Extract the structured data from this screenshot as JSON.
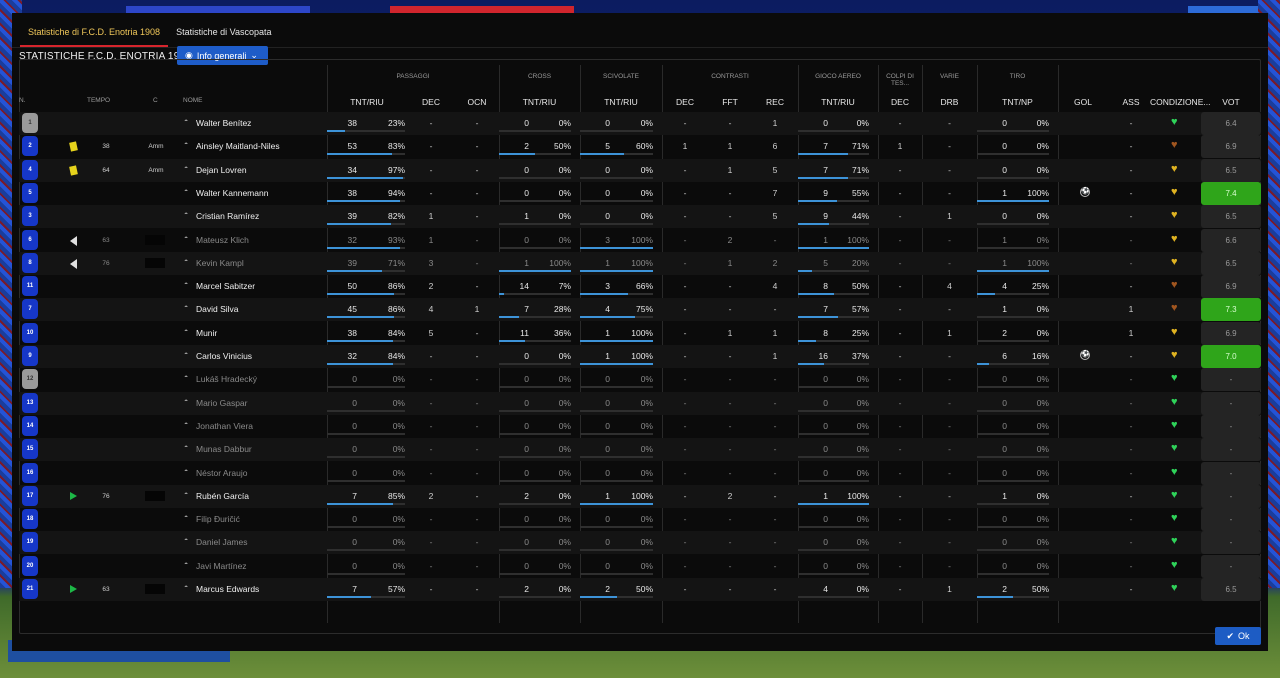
{
  "tabs": [
    {
      "label": "Statistiche di F.C.D. Enotria 1908",
      "active": true
    },
    {
      "label": "Statistiche di Vascopata",
      "active": false
    }
  ],
  "section_title": "STATISTICHE F.C.D. ENOTRIA 1908",
  "info_button": "Info generali",
  "groups": {
    "passaggi": "PASSAGGI",
    "cross": "CROSS",
    "scivolate": "SCIVOLATE",
    "contrasti": "CONTRASTI",
    "gioco_aereo": "GIOCO AEREO",
    "colpi_testa": "COLPI DI TES...",
    "varie": "VARIE",
    "tiro": "TIRO"
  },
  "columns": {
    "n": "N.",
    "tempo": "TEMPO",
    "c": "C",
    "nome": "NOME",
    "pas_tnt": "TNT/RIU",
    "pas_dec": "DEC",
    "pas_ocn": "OCN",
    "cross_tnt": "TNT/RIU",
    "sciv_tnt": "TNT/RIU",
    "con_dec": "DEC",
    "con_fft": "FFT",
    "con_rec": "REC",
    "aer_tnt": "TNT/RIU",
    "ct_dec": "DEC",
    "var_drb": "DRB",
    "tiro_tnt": "TNT/NP",
    "gol": "GOL",
    "ass": "ASS",
    "cond": "CONDIZIONE...",
    "vot": "VOT"
  },
  "ok_label": "Ok",
  "players": [
    {
      "num": "1",
      "gk": true,
      "tempo": "",
      "card": "",
      "c": "",
      "name": "Walter Benítez",
      "dim": false,
      "pas": [
        "38",
        "23%"
      ],
      "pas_bar": 0.23,
      "dec": "-",
      "ocn": "-",
      "cross": [
        "0",
        "0%"
      ],
      "cross_bar": 0,
      "sciv": [
        "0",
        "0%"
      ],
      "sciv_bar": 0,
      "cdec": "-",
      "fft": "-",
      "rec": "1",
      "aer": [
        "0",
        "0%"
      ],
      "aer_bar": 0,
      "ctdec": "-",
      "drb": "-",
      "tiro": [
        "0",
        "0%"
      ],
      "tiro_bar": 0,
      "gol": "",
      "ass": "-",
      "cond": "green",
      "vot": "6.4",
      "vot_good": false
    },
    {
      "num": "2",
      "gk": false,
      "tempo": "38",
      "card": "yellow",
      "c": "Amm",
      "name": "Ainsley Maitland-Niles",
      "dim": false,
      "pas": [
        "53",
        "83%"
      ],
      "pas_bar": 0.83,
      "dec": "-",
      "ocn": "-",
      "cross": [
        "2",
        "50%"
      ],
      "cross_bar": 0.5,
      "sciv": [
        "5",
        "60%"
      ],
      "sciv_bar": 0.6,
      "cdec": "1",
      "fft": "1",
      "rec": "6",
      "aer": [
        "7",
        "71%"
      ],
      "aer_bar": 0.71,
      "ctdec": "1",
      "drb": "-",
      "tiro": [
        "0",
        "0%"
      ],
      "tiro_bar": 0,
      "gol": "",
      "ass": "-",
      "cond": "brown",
      "vot": "6.9",
      "vot_good": false
    },
    {
      "num": "4",
      "gk": false,
      "tempo": "64",
      "card": "yellow",
      "c": "Amm",
      "name": "Dejan Lovren",
      "dim": false,
      "pas": [
        "34",
        "97%"
      ],
      "pas_bar": 0.97,
      "dec": "-",
      "ocn": "-",
      "cross": [
        "0",
        "0%"
      ],
      "cross_bar": 0,
      "sciv": [
        "0",
        "0%"
      ],
      "sciv_bar": 0,
      "cdec": "-",
      "fft": "1",
      "rec": "5",
      "aer": [
        "7",
        "71%"
      ],
      "aer_bar": 0.71,
      "ctdec": "-",
      "drb": "-",
      "tiro": [
        "0",
        "0%"
      ],
      "tiro_bar": 0,
      "gol": "",
      "ass": "-",
      "cond": "yellow",
      "vot": "6.5",
      "vot_good": false
    },
    {
      "num": "5",
      "gk": false,
      "tempo": "",
      "card": "",
      "c": "",
      "name": "Walter Kannemann",
      "dim": false,
      "pas": [
        "38",
        "94%"
      ],
      "pas_bar": 0.94,
      "dec": "-",
      "ocn": "-",
      "cross": [
        "0",
        "0%"
      ],
      "cross_bar": 0,
      "sciv": [
        "0",
        "0%"
      ],
      "sciv_bar": 0,
      "cdec": "-",
      "fft": "-",
      "rec": "7",
      "aer": [
        "9",
        "55%"
      ],
      "aer_bar": 0.55,
      "ctdec": "-",
      "drb": "-",
      "tiro": [
        "1",
        "100%"
      ],
      "tiro_bar": 1,
      "gol": "ball",
      "ass": "-",
      "cond": "yellow",
      "vot": "7.4",
      "vot_good": true
    },
    {
      "num": "3",
      "gk": false,
      "tempo": "",
      "card": "",
      "c": "",
      "name": "Cristian Ramírez",
      "dim": false,
      "pas": [
        "39",
        "82%"
      ],
      "pas_bar": 0.82,
      "dec": "1",
      "ocn": "-",
      "cross": [
        "1",
        "0%"
      ],
      "cross_bar": 0,
      "sciv": [
        "0",
        "0%"
      ],
      "sciv_bar": 0,
      "cdec": "-",
      "fft": "-",
      "rec": "5",
      "aer": [
        "9",
        "44%"
      ],
      "aer_bar": 0.44,
      "ctdec": "-",
      "drb": "1",
      "tiro": [
        "0",
        "0%"
      ],
      "tiro_bar": 0,
      "gol": "",
      "ass": "-",
      "cond": "yellow",
      "vot": "6.5",
      "vot_good": false
    },
    {
      "num": "6",
      "gk": false,
      "tempo": "63",
      "card": "out",
      "c": "",
      "name": "Mateusz Klich",
      "dim": true,
      "pas": [
        "32",
        "93%"
      ],
      "pas_bar": 0.93,
      "dec": "1",
      "ocn": "-",
      "cross": [
        "0",
        "0%"
      ],
      "cross_bar": 0,
      "sciv": [
        "3",
        "100%"
      ],
      "sciv_bar": 1,
      "cdec": "-",
      "fft": "2",
      "rec": "-",
      "aer": [
        "1",
        "100%"
      ],
      "aer_bar": 1,
      "ctdec": "-",
      "drb": "-",
      "tiro": [
        "1",
        "0%"
      ],
      "tiro_bar": 0,
      "gol": "",
      "ass": "-",
      "cond": "yellow",
      "vot": "6.6",
      "vot_good": false
    },
    {
      "num": "8",
      "gk": false,
      "tempo": "76",
      "card": "out",
      "c": "",
      "name": "Kevin Kampl",
      "dim": true,
      "pas": [
        "39",
        "71%"
      ],
      "pas_bar": 0.71,
      "dec": "3",
      "ocn": "-",
      "cross": [
        "1",
        "100%"
      ],
      "cross_bar": 1,
      "sciv": [
        "1",
        "100%"
      ],
      "sciv_bar": 1,
      "cdec": "-",
      "fft": "1",
      "rec": "2",
      "aer": [
        "5",
        "20%"
      ],
      "aer_bar": 0.2,
      "ctdec": "-",
      "drb": "-",
      "tiro": [
        "1",
        "100%"
      ],
      "tiro_bar": 1,
      "gol": "",
      "ass": "-",
      "cond": "yellow",
      "vot": "6.5",
      "vot_good": false
    },
    {
      "num": "11",
      "gk": false,
      "tempo": "",
      "card": "",
      "c": "",
      "name": "Marcel Sabitzer",
      "dim": false,
      "pas": [
        "50",
        "86%"
      ],
      "pas_bar": 0.86,
      "dec": "2",
      "ocn": "-",
      "cross": [
        "14",
        "7%"
      ],
      "cross_bar": 0.07,
      "sciv": [
        "3",
        "66%"
      ],
      "sciv_bar": 0.66,
      "cdec": "-",
      "fft": "-",
      "rec": "4",
      "aer": [
        "8",
        "50%"
      ],
      "aer_bar": 0.5,
      "ctdec": "-",
      "drb": "4",
      "tiro": [
        "4",
        "25%"
      ],
      "tiro_bar": 0.25,
      "gol": "",
      "ass": "-",
      "cond": "brown",
      "vot": "6.9",
      "vot_good": false
    },
    {
      "num": "7",
      "gk": false,
      "tempo": "",
      "card": "",
      "c": "",
      "name": "David Silva",
      "dim": false,
      "pas": [
        "45",
        "86%"
      ],
      "pas_bar": 0.86,
      "dec": "4",
      "ocn": "1",
      "cross": [
        "7",
        "28%"
      ],
      "cross_bar": 0.28,
      "sciv": [
        "4",
        "75%"
      ],
      "sciv_bar": 0.75,
      "cdec": "-",
      "fft": "-",
      "rec": "-",
      "aer": [
        "7",
        "57%"
      ],
      "aer_bar": 0.57,
      "ctdec": "-",
      "drb": "-",
      "tiro": [
        "1",
        "0%"
      ],
      "tiro_bar": 0,
      "gol": "",
      "ass": "1",
      "cond": "brown",
      "vot": "7.3",
      "vot_good": true
    },
    {
      "num": "10",
      "gk": false,
      "tempo": "",
      "card": "",
      "c": "",
      "name": "Munir",
      "dim": false,
      "pas": [
        "38",
        "84%"
      ],
      "pas_bar": 0.84,
      "dec": "5",
      "ocn": "-",
      "cross": [
        "11",
        "36%"
      ],
      "cross_bar": 0.36,
      "sciv": [
        "1",
        "100%"
      ],
      "sciv_bar": 1,
      "cdec": "-",
      "fft": "1",
      "rec": "1",
      "aer": [
        "8",
        "25%"
      ],
      "aer_bar": 0.25,
      "ctdec": "-",
      "drb": "1",
      "tiro": [
        "2",
        "0%"
      ],
      "tiro_bar": 0,
      "gol": "",
      "ass": "1",
      "cond": "yellow",
      "vot": "6.9",
      "vot_good": false
    },
    {
      "num": "9",
      "gk": false,
      "tempo": "",
      "card": "",
      "c": "",
      "name": "Carlos Vinicius",
      "dim": false,
      "pas": [
        "32",
        "84%"
      ],
      "pas_bar": 0.84,
      "dec": "-",
      "ocn": "-",
      "cross": [
        "0",
        "0%"
      ],
      "cross_bar": 0,
      "sciv": [
        "1",
        "100%"
      ],
      "sciv_bar": 1,
      "cdec": "-",
      "fft": "-",
      "rec": "1",
      "aer": [
        "16",
        "37%"
      ],
      "aer_bar": 0.37,
      "ctdec": "-",
      "drb": "-",
      "tiro": [
        "6",
        "16%"
      ],
      "tiro_bar": 0.16,
      "gol": "ball",
      "ass": "-",
      "cond": "yellow",
      "vot": "7.0",
      "vot_good": true
    },
    {
      "num": "12",
      "gk": true,
      "tempo": "",
      "card": "",
      "c": "",
      "name": "Lukáš Hradecký",
      "dim": true,
      "pas": [
        "0",
        "0%"
      ],
      "pas_bar": 0,
      "dec": "-",
      "ocn": "-",
      "cross": [
        "0",
        "0%"
      ],
      "cross_bar": 0,
      "sciv": [
        "0",
        "0%"
      ],
      "sciv_bar": 0,
      "cdec": "-",
      "fft": "-",
      "rec": "-",
      "aer": [
        "0",
        "0%"
      ],
      "aer_bar": 0,
      "ctdec": "-",
      "drb": "-",
      "tiro": [
        "0",
        "0%"
      ],
      "tiro_bar": 0,
      "gol": "",
      "ass": "-",
      "cond": "green",
      "vot": "-",
      "vot_good": false
    },
    {
      "num": "13",
      "gk": false,
      "tempo": "",
      "card": "",
      "c": "",
      "name": "Mario Gaspar",
      "dim": true,
      "pas": [
        "0",
        "0%"
      ],
      "pas_bar": 0,
      "dec": "-",
      "ocn": "-",
      "cross": [
        "0",
        "0%"
      ],
      "cross_bar": 0,
      "sciv": [
        "0",
        "0%"
      ],
      "sciv_bar": 0,
      "cdec": "-",
      "fft": "-",
      "rec": "-",
      "aer": [
        "0",
        "0%"
      ],
      "aer_bar": 0,
      "ctdec": "-",
      "drb": "-",
      "tiro": [
        "0",
        "0%"
      ],
      "tiro_bar": 0,
      "gol": "",
      "ass": "-",
      "cond": "green",
      "vot": "-",
      "vot_good": false
    },
    {
      "num": "14",
      "gk": false,
      "tempo": "",
      "card": "",
      "c": "",
      "name": "Jonathan Viera",
      "dim": true,
      "pas": [
        "0",
        "0%"
      ],
      "pas_bar": 0,
      "dec": "-",
      "ocn": "-",
      "cross": [
        "0",
        "0%"
      ],
      "cross_bar": 0,
      "sciv": [
        "0",
        "0%"
      ],
      "sciv_bar": 0,
      "cdec": "-",
      "fft": "-",
      "rec": "-",
      "aer": [
        "0",
        "0%"
      ],
      "aer_bar": 0,
      "ctdec": "-",
      "drb": "-",
      "tiro": [
        "0",
        "0%"
      ],
      "tiro_bar": 0,
      "gol": "",
      "ass": "-",
      "cond": "green",
      "vot": "-",
      "vot_good": false
    },
    {
      "num": "15",
      "gk": false,
      "tempo": "",
      "card": "",
      "c": "",
      "name": "Munas Dabbur",
      "dim": true,
      "pas": [
        "0",
        "0%"
      ],
      "pas_bar": 0,
      "dec": "-",
      "ocn": "-",
      "cross": [
        "0",
        "0%"
      ],
      "cross_bar": 0,
      "sciv": [
        "0",
        "0%"
      ],
      "sciv_bar": 0,
      "cdec": "-",
      "fft": "-",
      "rec": "-",
      "aer": [
        "0",
        "0%"
      ],
      "aer_bar": 0,
      "ctdec": "-",
      "drb": "-",
      "tiro": [
        "0",
        "0%"
      ],
      "tiro_bar": 0,
      "gol": "",
      "ass": "-",
      "cond": "green",
      "vot": "-",
      "vot_good": false
    },
    {
      "num": "16",
      "gk": false,
      "tempo": "",
      "card": "",
      "c": "",
      "name": "Néstor Araujo",
      "dim": true,
      "pas": [
        "0",
        "0%"
      ],
      "pas_bar": 0,
      "dec": "-",
      "ocn": "-",
      "cross": [
        "0",
        "0%"
      ],
      "cross_bar": 0,
      "sciv": [
        "0",
        "0%"
      ],
      "sciv_bar": 0,
      "cdec": "-",
      "fft": "-",
      "rec": "-",
      "aer": [
        "0",
        "0%"
      ],
      "aer_bar": 0,
      "ctdec": "-",
      "drb": "-",
      "tiro": [
        "0",
        "0%"
      ],
      "tiro_bar": 0,
      "gol": "",
      "ass": "-",
      "cond": "green",
      "vot": "-",
      "vot_good": false
    },
    {
      "num": "17",
      "gk": false,
      "tempo": "76",
      "card": "in",
      "c": "",
      "name": "Rubén García",
      "dim": false,
      "pas": [
        "7",
        "85%"
      ],
      "pas_bar": 0.85,
      "dec": "2",
      "ocn": "-",
      "cross": [
        "2",
        "0%"
      ],
      "cross_bar": 0,
      "sciv": [
        "1",
        "100%"
      ],
      "sciv_bar": 1,
      "cdec": "-",
      "fft": "2",
      "rec": "-",
      "aer": [
        "1",
        "100%"
      ],
      "aer_bar": 1,
      "ctdec": "-",
      "drb": "-",
      "tiro": [
        "1",
        "0%"
      ],
      "tiro_bar": 0,
      "gol": "",
      "ass": "-",
      "cond": "green",
      "vot": "-",
      "vot_good": false
    },
    {
      "num": "18",
      "gk": false,
      "tempo": "",
      "card": "",
      "c": "",
      "name": "Filip Đuričić",
      "dim": true,
      "pas": [
        "0",
        "0%"
      ],
      "pas_bar": 0,
      "dec": "-",
      "ocn": "-",
      "cross": [
        "0",
        "0%"
      ],
      "cross_bar": 0,
      "sciv": [
        "0",
        "0%"
      ],
      "sciv_bar": 0,
      "cdec": "-",
      "fft": "-",
      "rec": "-",
      "aer": [
        "0",
        "0%"
      ],
      "aer_bar": 0,
      "ctdec": "-",
      "drb": "-",
      "tiro": [
        "0",
        "0%"
      ],
      "tiro_bar": 0,
      "gol": "",
      "ass": "-",
      "cond": "green",
      "vot": "-",
      "vot_good": false
    },
    {
      "num": "19",
      "gk": false,
      "tempo": "",
      "card": "",
      "c": "",
      "name": "Daniel James",
      "dim": true,
      "pas": [
        "0",
        "0%"
      ],
      "pas_bar": 0,
      "dec": "-",
      "ocn": "-",
      "cross": [
        "0",
        "0%"
      ],
      "cross_bar": 0,
      "sciv": [
        "0",
        "0%"
      ],
      "sciv_bar": 0,
      "cdec": "-",
      "fft": "-",
      "rec": "-",
      "aer": [
        "0",
        "0%"
      ],
      "aer_bar": 0,
      "ctdec": "-",
      "drb": "-",
      "tiro": [
        "0",
        "0%"
      ],
      "tiro_bar": 0,
      "gol": "",
      "ass": "-",
      "cond": "green",
      "vot": "-",
      "vot_good": false
    },
    {
      "num": "20",
      "gk": false,
      "tempo": "",
      "card": "",
      "c": "",
      "name": "Javi Martínez",
      "dim": true,
      "pas": [
        "0",
        "0%"
      ],
      "pas_bar": 0,
      "dec": "-",
      "ocn": "-",
      "cross": [
        "0",
        "0%"
      ],
      "cross_bar": 0,
      "sciv": [
        "0",
        "0%"
      ],
      "sciv_bar": 0,
      "cdec": "-",
      "fft": "-",
      "rec": "-",
      "aer": [
        "0",
        "0%"
      ],
      "aer_bar": 0,
      "ctdec": "-",
      "drb": "-",
      "tiro": [
        "0",
        "0%"
      ],
      "tiro_bar": 0,
      "gol": "",
      "ass": "-",
      "cond": "green",
      "vot": "-",
      "vot_good": false
    },
    {
      "num": "21",
      "gk": false,
      "tempo": "63",
      "card": "in",
      "c": "",
      "name": "Marcus Edwards",
      "dim": false,
      "pas": [
        "7",
        "57%"
      ],
      "pas_bar": 0.57,
      "dec": "-",
      "ocn": "-",
      "cross": [
        "2",
        "0%"
      ],
      "cross_bar": 0,
      "sciv": [
        "2",
        "50%"
      ],
      "sciv_bar": 0.5,
      "cdec": "-",
      "fft": "-",
      "rec": "-",
      "aer": [
        "4",
        "0%"
      ],
      "aer_bar": 0,
      "ctdec": "-",
      "drb": "1",
      "tiro": [
        "2",
        "50%"
      ],
      "tiro_bar": 0.5,
      "gol": "",
      "ass": "-",
      "cond": "green",
      "vot": "6.5",
      "vot_good": false
    }
  ]
}
